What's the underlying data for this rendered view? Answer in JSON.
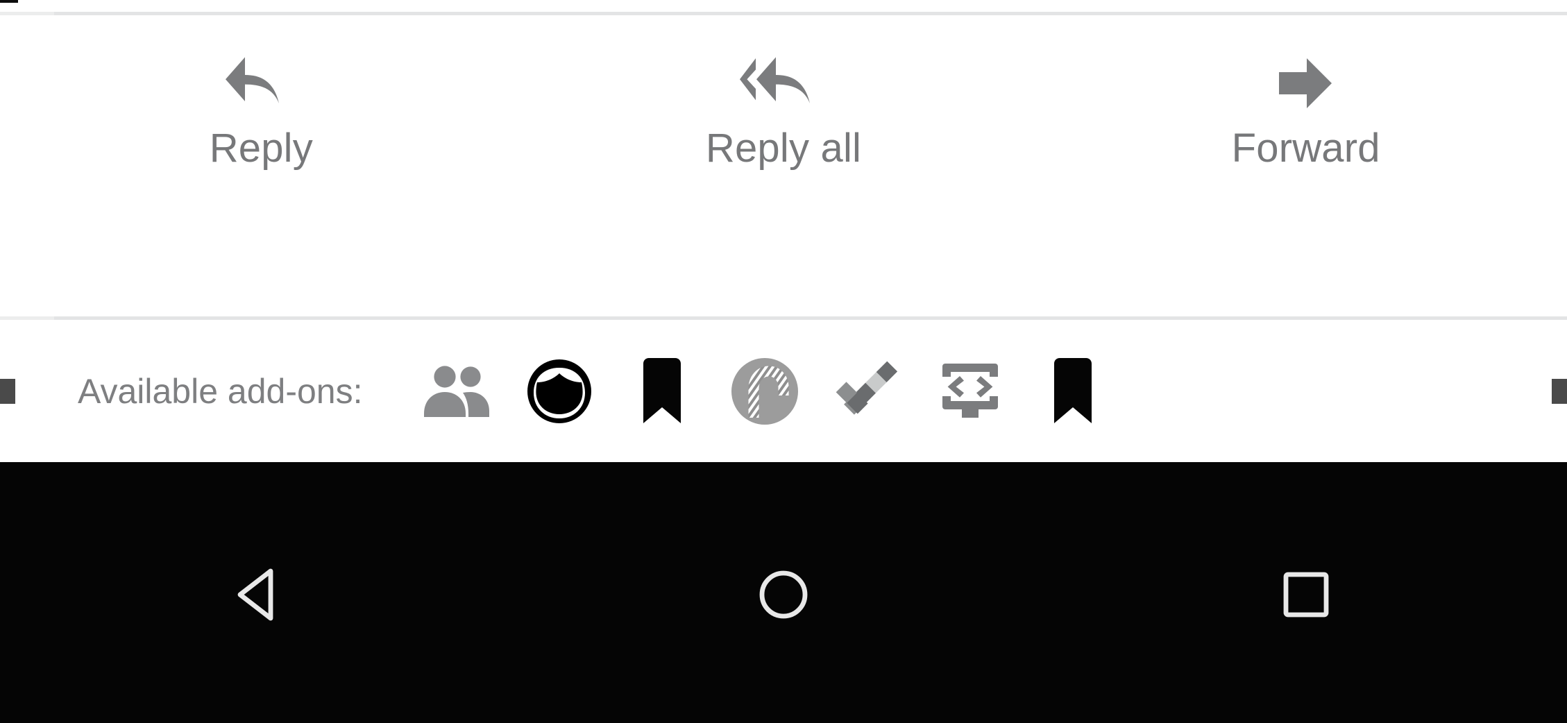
{
  "app": {
    "context": "email-message-footer",
    "background_color": "#ffffff",
    "divider_color": "#e3e4e5",
    "label_color": "#77787a",
    "icon_color": "#7b7c7e"
  },
  "action_bar": {
    "items": [
      {
        "id": "reply",
        "label": "Reply",
        "icon": "reply-arrow-icon"
      },
      {
        "id": "reply-all",
        "label": "Reply all",
        "icon": "reply-all-arrow-icon"
      },
      {
        "id": "forward",
        "label": "Forward",
        "icon": "forward-arrow-icon"
      }
    ]
  },
  "addons_bar": {
    "label": "Available add-ons:",
    "icons": [
      {
        "id": "contacts",
        "name": "people-icon",
        "color": "#8a8b8d"
      },
      {
        "id": "profile",
        "name": "face-avatar-icon",
        "color": "#000000"
      },
      {
        "id": "bookmark1",
        "name": "bookmark-icon",
        "color": "#050505"
      },
      {
        "id": "candy",
        "name": "candy-cane-badge-icon",
        "color": "#9c9c9c"
      },
      {
        "id": "tasks",
        "name": "checkmark-icon",
        "color": "#6f7173"
      },
      {
        "id": "code",
        "name": "code-screen-icon",
        "color": "#7b7c7e"
      },
      {
        "id": "bookmark2",
        "name": "bookmark-icon",
        "color": "#050505"
      }
    ]
  },
  "nav_bar": {
    "background_color": "#050505",
    "buttons": [
      {
        "id": "back",
        "name": "back-triangle-icon"
      },
      {
        "id": "home",
        "name": "home-circle-icon"
      },
      {
        "id": "recents",
        "name": "recents-square-icon"
      }
    ]
  }
}
